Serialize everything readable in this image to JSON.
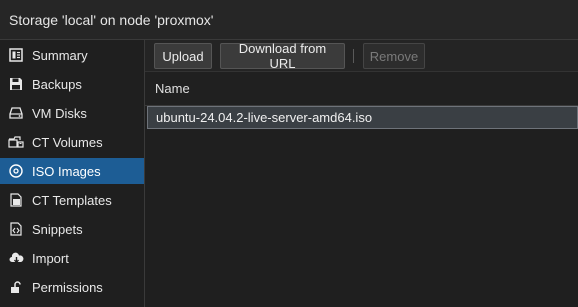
{
  "window": {
    "title": "Storage 'local' on node 'proxmox'"
  },
  "sidebar": {
    "items": [
      {
        "label": "Summary",
        "icon": "summary-icon",
        "active": false
      },
      {
        "label": "Backups",
        "icon": "floppy-icon",
        "active": false
      },
      {
        "label": "VM Disks",
        "icon": "hard-drive-icon",
        "active": false
      },
      {
        "label": "CT Volumes",
        "icon": "ct-volume-icon",
        "active": false
      },
      {
        "label": "ISO Images",
        "icon": "disc-icon",
        "active": true
      },
      {
        "label": "CT Templates",
        "icon": "template-icon",
        "active": false
      },
      {
        "label": "Snippets",
        "icon": "file-code-icon",
        "active": false
      },
      {
        "label": "Import",
        "icon": "cloud-download-icon",
        "active": false
      },
      {
        "label": "Permissions",
        "icon": "unlock-icon",
        "active": false
      }
    ]
  },
  "toolbar": {
    "upload_label": "Upload",
    "download_url_label": "Download from URL",
    "remove_label": "Remove",
    "remove_disabled": true
  },
  "grid": {
    "columns": [
      "Name"
    ],
    "rows": [
      {
        "name": "ubuntu-24.04.2-live-server-amd64.iso",
        "selected": true
      }
    ]
  },
  "colors": {
    "background": "#1f1f1f",
    "active_nav": "#1d5d95",
    "selected_row": "#3a3f44",
    "text": "#e8e8e8"
  }
}
